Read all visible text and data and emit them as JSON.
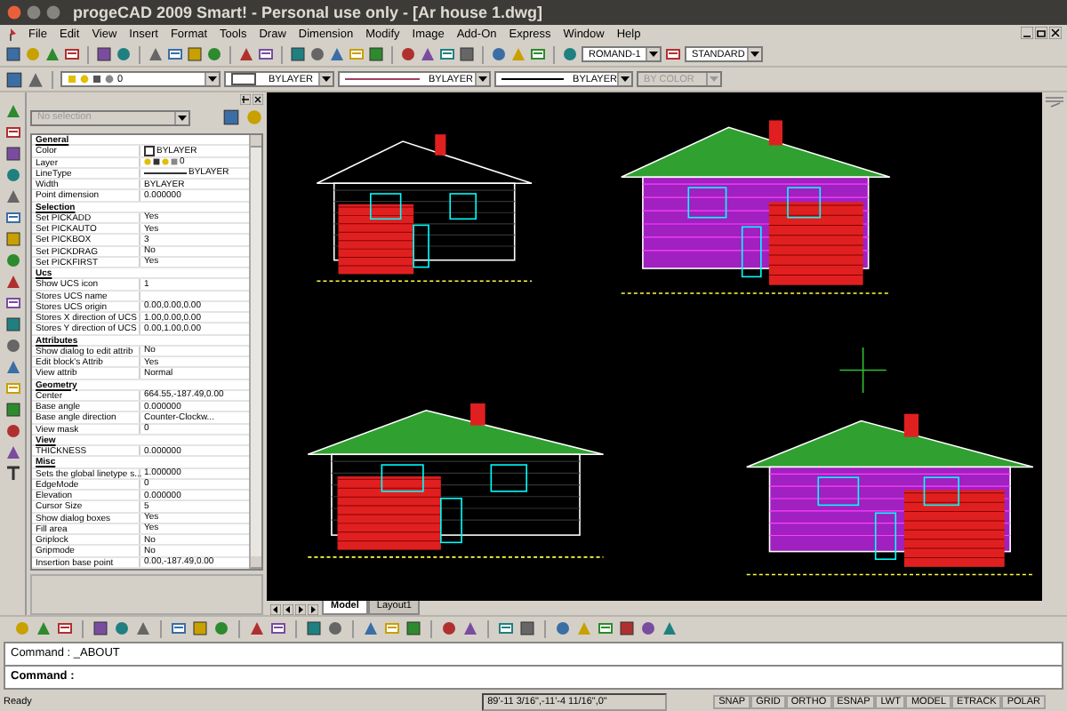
{
  "window": {
    "title": "progeCAD 2009 Smart! - Personal use only - [Ar house 1.dwg]"
  },
  "menu": [
    "File",
    "Edit",
    "View",
    "Insert",
    "Format",
    "Tools",
    "Draw",
    "Dimension",
    "Modify",
    "Image",
    "Add-On",
    "Express",
    "Window",
    "Help"
  ],
  "toolbar": {
    "text_font": "ROMAND-1",
    "text_style": "STANDARD"
  },
  "layer_bar": {
    "layer": "0",
    "color_value": "BYLAYER",
    "linetype": "BYLAYER",
    "lineweight": "BYLAYER",
    "plot_style": {
      "value": "BY COLOR",
      "disabled": true
    }
  },
  "properties": {
    "selection": "No selection",
    "rows": [
      {
        "kind": "section",
        "name": "General"
      },
      {
        "kind": "color",
        "name": "Color",
        "value": "BYLAYER"
      },
      {
        "kind": "layer",
        "name": "Layer",
        "value": "0"
      },
      {
        "kind": "linetype",
        "name": "LineType",
        "value": "BYLAYER"
      },
      {
        "kind": "text",
        "name": "Width",
        "value": "BYLAYER"
      },
      {
        "kind": "text",
        "name": "Point dimension",
        "value": "0.000000"
      },
      {
        "kind": "section",
        "name": "Selection"
      },
      {
        "kind": "text",
        "name": "Set PICKADD",
        "value": "Yes"
      },
      {
        "kind": "text",
        "name": "Set PICKAUTO",
        "value": "Yes"
      },
      {
        "kind": "text",
        "name": "Set PICKBOX",
        "value": "3"
      },
      {
        "kind": "text",
        "name": "Set PICKDRAG",
        "value": "No"
      },
      {
        "kind": "text",
        "name": "Set PICKFIRST",
        "value": "Yes"
      },
      {
        "kind": "section",
        "name": "Ucs"
      },
      {
        "kind": "text",
        "name": "Show UCS icon",
        "value": "1"
      },
      {
        "kind": "text",
        "name": "Stores UCS name"
      },
      {
        "kind": "text",
        "name": "Stores UCS origin",
        "value": "0.00,0.00,0.00"
      },
      {
        "kind": "text",
        "name": "Stores X direction of UCS",
        "value": "1.00,0.00,0.00"
      },
      {
        "kind": "text",
        "name": "Stores Y direction of UCS",
        "value": "0.00,1.00,0.00"
      },
      {
        "kind": "section",
        "name": "Attributes"
      },
      {
        "kind": "text",
        "name": "Show dialog to edit attrib",
        "value": "No"
      },
      {
        "kind": "text",
        "name": "Edit block's Attrib",
        "value": "Yes"
      },
      {
        "kind": "text",
        "name": "View attrib",
        "value": "Normal"
      },
      {
        "kind": "section",
        "name": "Geometry"
      },
      {
        "kind": "text",
        "name": "Center",
        "value": "664.55,-187.49,0.00"
      },
      {
        "kind": "text",
        "name": "Base angle",
        "value": "0.000000"
      },
      {
        "kind": "text",
        "name": "Base angle direction",
        "value": "Counter-Clockw..."
      },
      {
        "kind": "text",
        "name": "View mask",
        "value": "0"
      },
      {
        "kind": "section",
        "name": "View"
      },
      {
        "kind": "text",
        "name": "THICKNESS",
        "value": "0.000000"
      },
      {
        "kind": "section",
        "name": "Misc"
      },
      {
        "kind": "text",
        "name": "Sets the global linetype s...",
        "value": "1.000000"
      },
      {
        "kind": "text",
        "name": "EdgeMode",
        "value": "0"
      },
      {
        "kind": "text",
        "name": "Elevation",
        "value": "0.000000"
      },
      {
        "kind": "text",
        "name": "Cursor Size",
        "value": "5"
      },
      {
        "kind": "text",
        "name": "Show dialog boxes",
        "value": "Yes"
      },
      {
        "kind": "text",
        "name": "Fill area",
        "value": "Yes"
      },
      {
        "kind": "text",
        "name": "Griplock",
        "value": "No"
      },
      {
        "kind": "text",
        "name": "Gripmode",
        "value": "No"
      },
      {
        "kind": "text",
        "name": "Insertion base point",
        "value": "0.00,-187.49,0.00"
      }
    ]
  },
  "layout_tabs": [
    {
      "label": "Model",
      "selected": true
    },
    {
      "label": "Layout1",
      "selected": false
    }
  ],
  "command": {
    "history": "Command : _ABOUT",
    "prompt": "Command :"
  },
  "status_bar": {
    "message": "Ready",
    "coordinates": "89'-11 3/16\",-11'-4 11/16\",0\"",
    "buttons": [
      "SNAP",
      "GRID",
      "ORTHO",
      "ESNAP",
      "LWT",
      "MODEL",
      "ETRACK",
      "POLAR"
    ]
  }
}
